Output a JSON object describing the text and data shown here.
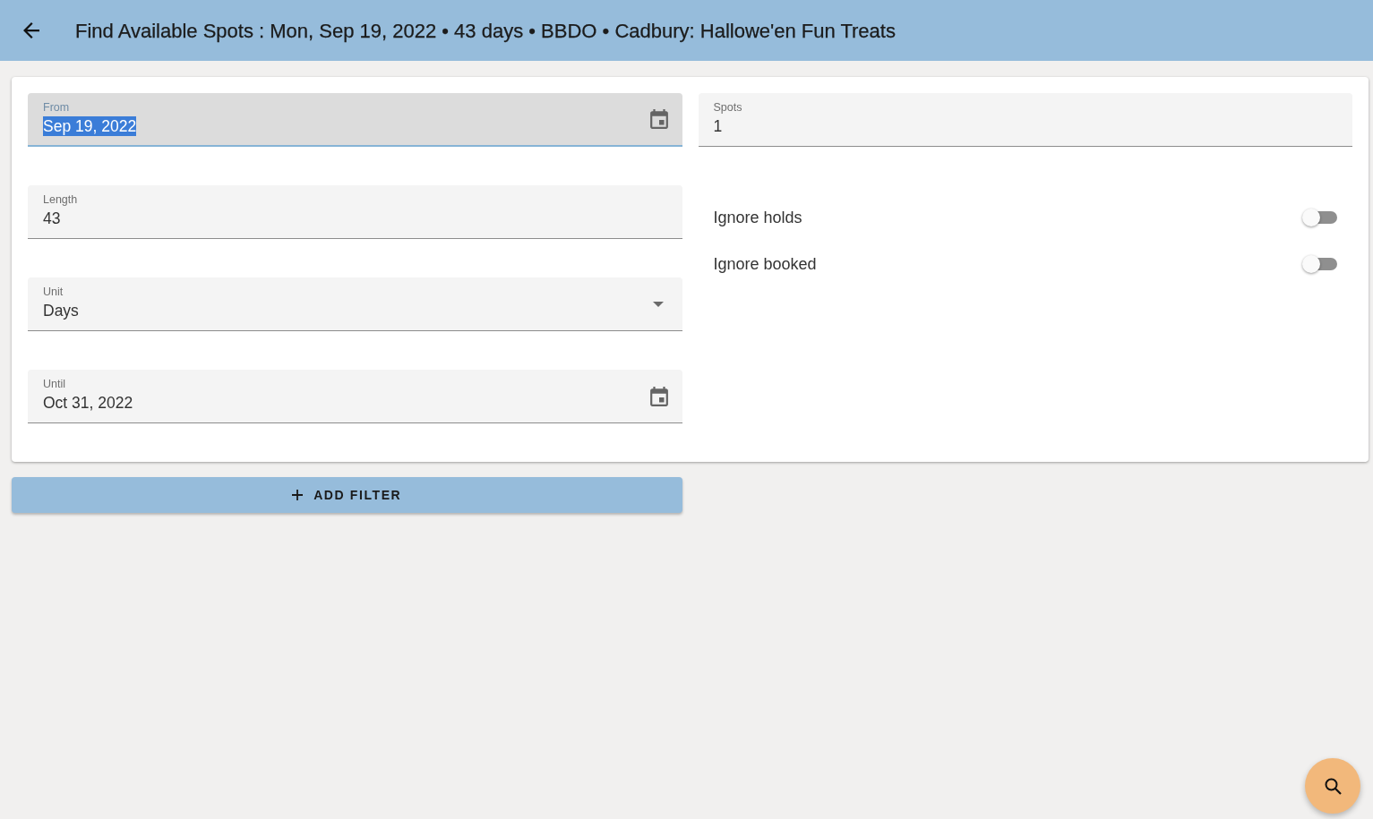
{
  "header": {
    "title": "Find Available Spots : Mon, Sep 19, 2022 • 43 days • BBDO • Cadbury: Hallowe'en Fun Treats"
  },
  "form": {
    "left_fields": [
      {
        "kind": "date",
        "label": "From",
        "value": "Sep 19, 2022",
        "focused": true
      },
      {
        "kind": "text",
        "label": "Length",
        "value": "43",
        "focused": false
      },
      {
        "kind": "select",
        "label": "Unit",
        "value": "Days",
        "focused": false
      },
      {
        "kind": "date",
        "label": "Until",
        "value": "Oct 31, 2022",
        "focused": false
      }
    ],
    "right_fields": [
      {
        "kind": "text",
        "label": "Spots",
        "value": "1",
        "focused": false
      }
    ],
    "switches": [
      {
        "label": "Ignore holds",
        "on": false
      },
      {
        "label": "Ignore booked",
        "on": false
      }
    ]
  },
  "add_filter_button": {
    "label": "ADD FILTER"
  }
}
